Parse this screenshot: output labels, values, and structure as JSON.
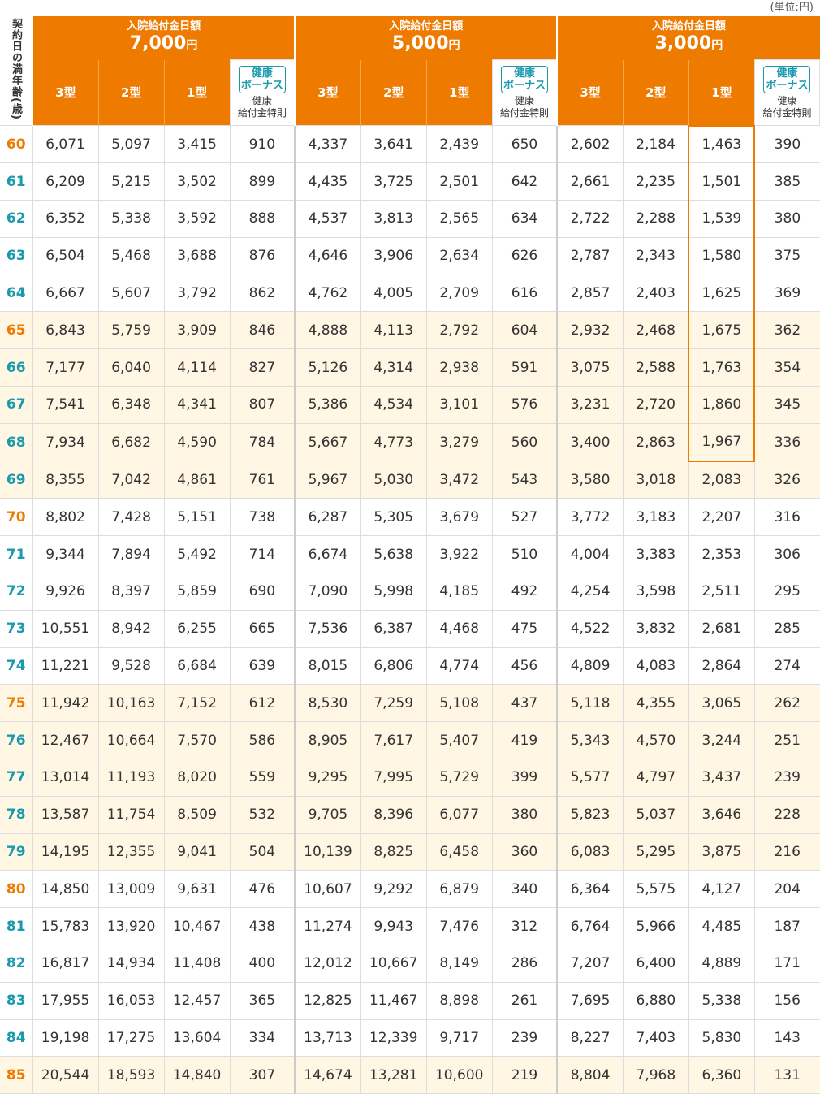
{
  "unit_label": "(単位:円)",
  "age_header": "契約日の満年齢(歳)",
  "groups": [
    {
      "title": "入院給付金日額",
      "amount": "7,000",
      "yen": "円"
    },
    {
      "title": "入院給付金日額",
      "amount": "5,000",
      "yen": "円"
    },
    {
      "title": "入院給付金日額",
      "amount": "3,000",
      "yen": "円"
    }
  ],
  "types": [
    "3型",
    "2型",
    "1型"
  ],
  "bonus_badge": "健康\nボーナス",
  "bonus_sub": "健康\n給付金特則",
  "colors": {
    "accent": "#ee7a00",
    "teal": "#1a9aad",
    "highlight_row": "#fff7e3"
  },
  "highlight": {
    "column": 10,
    "from_age": "60",
    "to_age": "68"
  },
  "rows": [
    {
      "age": "60",
      "age_color": "orange",
      "shade": false,
      "v": [
        "6,071",
        "5,097",
        "3,415",
        "910",
        "4,337",
        "3,641",
        "2,439",
        "650",
        "2,602",
        "2,184",
        "1,463",
        "390"
      ]
    },
    {
      "age": "61",
      "age_color": "teal",
      "shade": false,
      "v": [
        "6,209",
        "5,215",
        "3,502",
        "899",
        "4,435",
        "3,725",
        "2,501",
        "642",
        "2,661",
        "2,235",
        "1,501",
        "385"
      ]
    },
    {
      "age": "62",
      "age_color": "teal",
      "shade": false,
      "v": [
        "6,352",
        "5,338",
        "3,592",
        "888",
        "4,537",
        "3,813",
        "2,565",
        "634",
        "2,722",
        "2,288",
        "1,539",
        "380"
      ]
    },
    {
      "age": "63",
      "age_color": "teal",
      "shade": false,
      "v": [
        "6,504",
        "5,468",
        "3,688",
        "876",
        "4,646",
        "3,906",
        "2,634",
        "626",
        "2,787",
        "2,343",
        "1,580",
        "375"
      ]
    },
    {
      "age": "64",
      "age_color": "teal",
      "shade": false,
      "v": [
        "6,667",
        "5,607",
        "3,792",
        "862",
        "4,762",
        "4,005",
        "2,709",
        "616",
        "2,857",
        "2,403",
        "1,625",
        "369"
      ]
    },
    {
      "age": "65",
      "age_color": "orange",
      "shade": true,
      "v": [
        "6,843",
        "5,759",
        "3,909",
        "846",
        "4,888",
        "4,113",
        "2,792",
        "604",
        "2,932",
        "2,468",
        "1,675",
        "362"
      ]
    },
    {
      "age": "66",
      "age_color": "teal",
      "shade": true,
      "v": [
        "7,177",
        "6,040",
        "4,114",
        "827",
        "5,126",
        "4,314",
        "2,938",
        "591",
        "3,075",
        "2,588",
        "1,763",
        "354"
      ]
    },
    {
      "age": "67",
      "age_color": "teal",
      "shade": true,
      "v": [
        "7,541",
        "6,348",
        "4,341",
        "807",
        "5,386",
        "4,534",
        "3,101",
        "576",
        "3,231",
        "2,720",
        "1,860",
        "345"
      ]
    },
    {
      "age": "68",
      "age_color": "teal",
      "shade": true,
      "v": [
        "7,934",
        "6,682",
        "4,590",
        "784",
        "5,667",
        "4,773",
        "3,279",
        "560",
        "3,400",
        "2,863",
        "1,967",
        "336"
      ]
    },
    {
      "age": "69",
      "age_color": "teal",
      "shade": true,
      "v": [
        "8,355",
        "7,042",
        "4,861",
        "761",
        "5,967",
        "5,030",
        "3,472",
        "543",
        "3,580",
        "3,018",
        "2,083",
        "326"
      ]
    },
    {
      "age": "70",
      "age_color": "orange",
      "shade": false,
      "v": [
        "8,802",
        "7,428",
        "5,151",
        "738",
        "6,287",
        "5,305",
        "3,679",
        "527",
        "3,772",
        "3,183",
        "2,207",
        "316"
      ]
    },
    {
      "age": "71",
      "age_color": "teal",
      "shade": false,
      "v": [
        "9,344",
        "7,894",
        "5,492",
        "714",
        "6,674",
        "5,638",
        "3,922",
        "510",
        "4,004",
        "3,383",
        "2,353",
        "306"
      ]
    },
    {
      "age": "72",
      "age_color": "teal",
      "shade": false,
      "v": [
        "9,926",
        "8,397",
        "5,859",
        "690",
        "7,090",
        "5,998",
        "4,185",
        "492",
        "4,254",
        "3,598",
        "2,511",
        "295"
      ]
    },
    {
      "age": "73",
      "age_color": "teal",
      "shade": false,
      "v": [
        "10,551",
        "8,942",
        "6,255",
        "665",
        "7,536",
        "6,387",
        "4,468",
        "475",
        "4,522",
        "3,832",
        "2,681",
        "285"
      ]
    },
    {
      "age": "74",
      "age_color": "teal",
      "shade": false,
      "v": [
        "11,221",
        "9,528",
        "6,684",
        "639",
        "8,015",
        "6,806",
        "4,774",
        "456",
        "4,809",
        "4,083",
        "2,864",
        "274"
      ]
    },
    {
      "age": "75",
      "age_color": "orange",
      "shade": true,
      "v": [
        "11,942",
        "10,163",
        "7,152",
        "612",
        "8,530",
        "7,259",
        "5,108",
        "437",
        "5,118",
        "4,355",
        "3,065",
        "262"
      ]
    },
    {
      "age": "76",
      "age_color": "teal",
      "shade": true,
      "v": [
        "12,467",
        "10,664",
        "7,570",
        "586",
        "8,905",
        "7,617",
        "5,407",
        "419",
        "5,343",
        "4,570",
        "3,244",
        "251"
      ]
    },
    {
      "age": "77",
      "age_color": "teal",
      "shade": true,
      "v": [
        "13,014",
        "11,193",
        "8,020",
        "559",
        "9,295",
        "7,995",
        "5,729",
        "399",
        "5,577",
        "4,797",
        "3,437",
        "239"
      ]
    },
    {
      "age": "78",
      "age_color": "teal",
      "shade": true,
      "v": [
        "13,587",
        "11,754",
        "8,509",
        "532",
        "9,705",
        "8,396",
        "6,077",
        "380",
        "5,823",
        "5,037",
        "3,646",
        "228"
      ]
    },
    {
      "age": "79",
      "age_color": "teal",
      "shade": true,
      "v": [
        "14,195",
        "12,355",
        "9,041",
        "504",
        "10,139",
        "8,825",
        "6,458",
        "360",
        "6,083",
        "5,295",
        "3,875",
        "216"
      ]
    },
    {
      "age": "80",
      "age_color": "orange",
      "shade": false,
      "v": [
        "14,850",
        "13,009",
        "9,631",
        "476",
        "10,607",
        "9,292",
        "6,879",
        "340",
        "6,364",
        "5,575",
        "4,127",
        "204"
      ]
    },
    {
      "age": "81",
      "age_color": "teal",
      "shade": false,
      "v": [
        "15,783",
        "13,920",
        "10,467",
        "438",
        "11,274",
        "9,943",
        "7,476",
        "312",
        "6,764",
        "5,966",
        "4,485",
        "187"
      ]
    },
    {
      "age": "82",
      "age_color": "teal",
      "shade": false,
      "v": [
        "16,817",
        "14,934",
        "11,408",
        "400",
        "12,012",
        "10,667",
        "8,149",
        "286",
        "7,207",
        "6,400",
        "4,889",
        "171"
      ]
    },
    {
      "age": "83",
      "age_color": "teal",
      "shade": false,
      "v": [
        "17,955",
        "16,053",
        "12,457",
        "365",
        "12,825",
        "11,467",
        "8,898",
        "261",
        "7,695",
        "6,880",
        "5,338",
        "156"
      ]
    },
    {
      "age": "84",
      "age_color": "teal",
      "shade": false,
      "v": [
        "19,198",
        "17,275",
        "13,604",
        "334",
        "13,713",
        "12,339",
        "9,717",
        "239",
        "8,227",
        "7,403",
        "5,830",
        "143"
      ]
    },
    {
      "age": "85",
      "age_color": "orange",
      "shade": true,
      "v": [
        "20,544",
        "18,593",
        "14,840",
        "307",
        "14,674",
        "13,281",
        "10,600",
        "219",
        "8,804",
        "7,968",
        "6,360",
        "131"
      ]
    }
  ]
}
